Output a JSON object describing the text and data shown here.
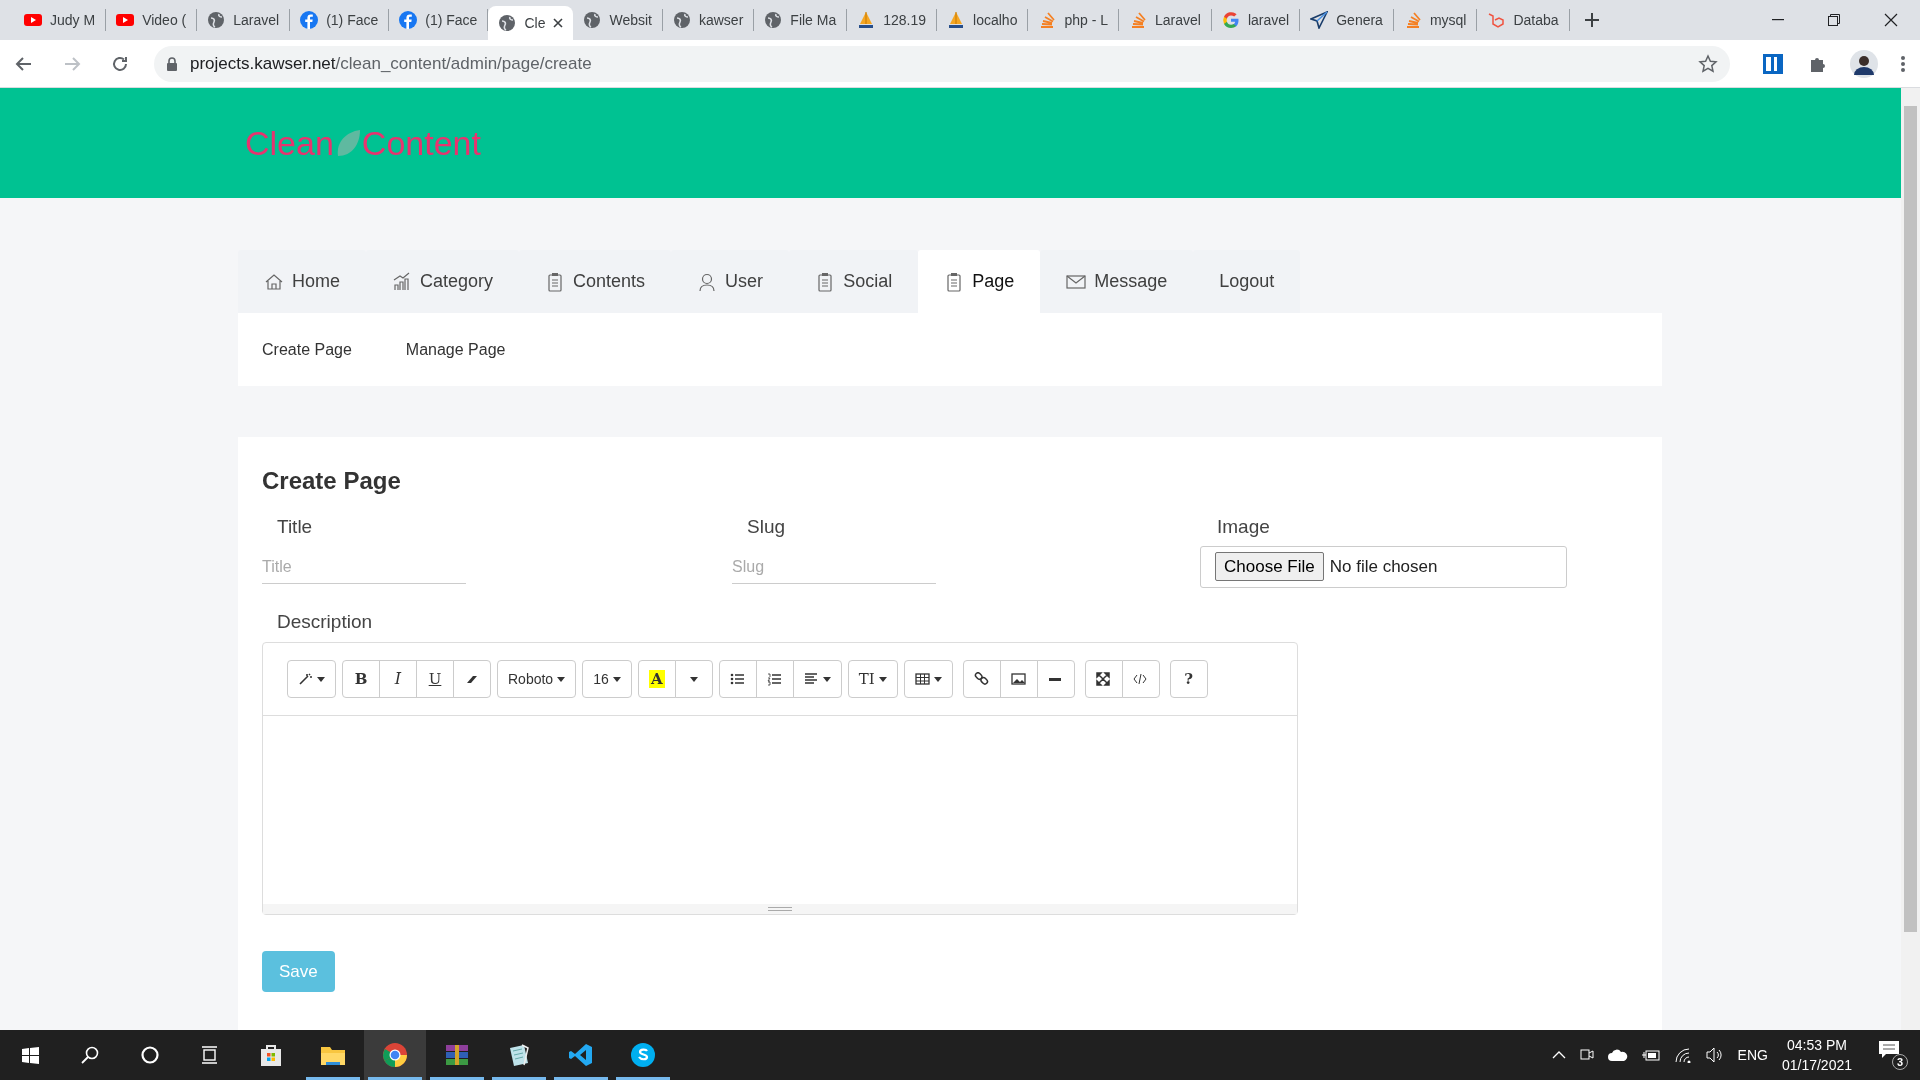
{
  "browser": {
    "tabs": [
      {
        "label": "Judy M",
        "kind": "youtube",
        "selected": false
      },
      {
        "label": "Video (",
        "kind": "youtube",
        "selected": false
      },
      {
        "label": "Laravel",
        "kind": "globe",
        "selected": false
      },
      {
        "label": "(1) Face",
        "kind": "facebook",
        "selected": false
      },
      {
        "label": "(1) Face",
        "kind": "facebook",
        "selected": false
      },
      {
        "label": "Cle",
        "kind": "globe",
        "selected": true
      },
      {
        "label": "Websit",
        "kind": "globe",
        "selected": false
      },
      {
        "label": "kawser",
        "kind": "globe",
        "selected": false
      },
      {
        "label": "File Ma",
        "kind": "globe",
        "selected": false
      },
      {
        "label": "128.19",
        "kind": "pma",
        "selected": false
      },
      {
        "label": "localho",
        "kind": "pma",
        "selected": false
      },
      {
        "label": "php - L",
        "kind": "stack",
        "selected": false
      },
      {
        "label": "Laravel",
        "kind": "stack",
        "selected": false
      },
      {
        "label": "laravel",
        "kind": "google",
        "selected": false
      },
      {
        "label": "Genera",
        "kind": "plane",
        "selected": false
      },
      {
        "label": "mysql",
        "kind": "stack",
        "selected": false
      },
      {
        "label": "Databa",
        "kind": "laravel",
        "selected": false
      }
    ],
    "url_host": "projects.kawser.net",
    "url_path": "/clean_content/admin/page/create"
  },
  "site": {
    "logo_left": "Clean",
    "logo_right": "Content"
  },
  "nav": [
    {
      "label": "Home",
      "kind": "home",
      "selected": false
    },
    {
      "label": "Category",
      "kind": "chart",
      "selected": false
    },
    {
      "label": "Contents",
      "kind": "clipboard",
      "selected": false
    },
    {
      "label": "User",
      "kind": "user",
      "selected": false
    },
    {
      "label": "Social",
      "kind": "clipboard",
      "selected": false
    },
    {
      "label": "Page",
      "kind": "clipboard",
      "selected": true
    },
    {
      "label": "Message",
      "kind": "mail",
      "selected": false
    },
    {
      "label": "Logout",
      "kind": "plain",
      "selected": false
    }
  ],
  "subnav": [
    "Create Page",
    "Manage Page"
  ],
  "form": {
    "heading": "Create Page",
    "fields": [
      {
        "kind": "text",
        "label": "Title",
        "placeholder": "Title"
      },
      {
        "kind": "text",
        "label": "Slug",
        "placeholder": "Slug"
      },
      {
        "kind": "file",
        "label": "Image",
        "button": "Choose File",
        "status": "No file chosen"
      }
    ],
    "description_label": "Description",
    "toolbar": [
      [
        {
          "kind": "magic",
          "caret": true
        }
      ],
      [
        {
          "kind": "bold",
          "label": "B"
        },
        {
          "kind": "italic",
          "label": "I"
        },
        {
          "kind": "underline",
          "label": "U"
        },
        {
          "kind": "eraser",
          "caret": false
        }
      ],
      [
        {
          "kind": "plain",
          "label": "Roboto",
          "caret": true
        }
      ],
      [
        {
          "kind": "plain",
          "label": "16",
          "caret": true
        }
      ],
      [
        {
          "kind": "highlight",
          "label": "A"
        },
        {
          "kind": "dropdown",
          "caret": true
        }
      ],
      [
        {
          "kind": "ul",
          "caret": false
        },
        {
          "kind": "ol",
          "caret": false
        },
        {
          "kind": "align",
          "caret": true
        }
      ],
      [
        {
          "kind": "serif",
          "label": "TI",
          "caret": true
        }
      ],
      [
        {
          "kind": "table",
          "caret": true
        }
      ],
      [
        {
          "kind": "link",
          "caret": false
        },
        {
          "kind": "image",
          "caret": false
        },
        {
          "kind": "hr",
          "caret": false
        }
      ],
      [
        {
          "kind": "expand",
          "caret": false
        },
        {
          "kind": "code",
          "caret": false
        }
      ],
      [
        {
          "kind": "bold",
          "label": "?"
        }
      ]
    ],
    "save": "Save"
  },
  "taskbar": {
    "apps": [
      {
        "kind": "store",
        "running": false,
        "selected": false
      },
      {
        "kind": "folder",
        "running": true,
        "selected": false
      },
      {
        "kind": "chrome",
        "running": true,
        "selected": true
      },
      {
        "kind": "archive",
        "running": true,
        "selected": false
      },
      {
        "kind": "notepad",
        "running": true,
        "selected": false
      },
      {
        "kind": "vscode",
        "running": true,
        "selected": false
      },
      {
        "kind": "skype",
        "running": true,
        "selected": false
      }
    ],
    "language": "ENG",
    "time": "04:53 PM",
    "date": "01/17/2021",
    "notifications": "3"
  }
}
